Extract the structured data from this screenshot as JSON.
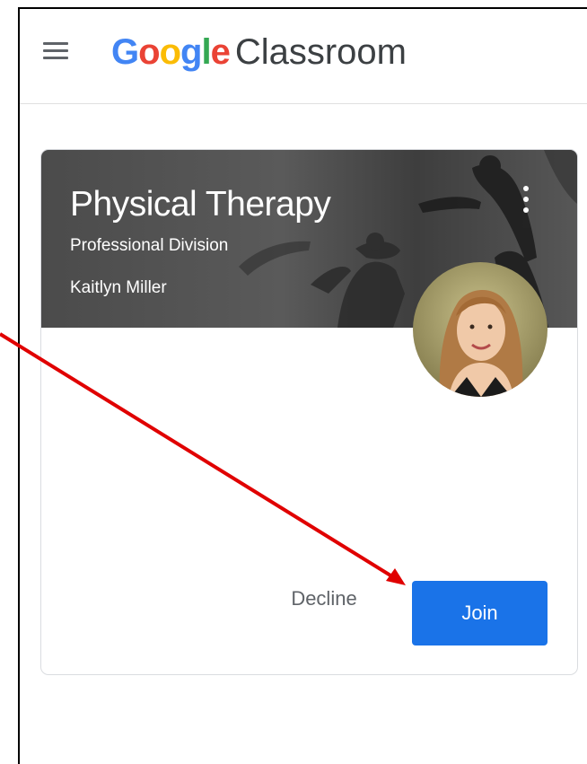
{
  "header": {
    "brand_google_letters": [
      "G",
      "o",
      "o",
      "g",
      "l",
      "e"
    ],
    "brand_product": "Classroom"
  },
  "card": {
    "title": "Physical Therapy",
    "section": "Professional Division",
    "teacher": "Kaitlyn Miller",
    "decline_label": "Decline",
    "join_label": "Join"
  },
  "colors": {
    "google_letters": [
      "#4285F4",
      "#EA4335",
      "#FBBC05",
      "#4285F4",
      "#34A853",
      "#EA4335"
    ],
    "join_button": "#1a73e8",
    "annotation_arrow": "#e00000"
  },
  "icons": {
    "menu": "hamburger-menu-icon",
    "more": "more-vert-icon",
    "avatar": "teacher-avatar-photo"
  }
}
